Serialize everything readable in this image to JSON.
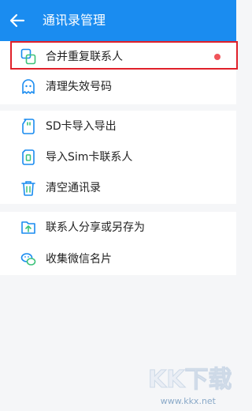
{
  "header": {
    "title": "通讯录管理",
    "back_icon": "arrow-left-icon",
    "background": "#1a8cf0"
  },
  "groups": [
    {
      "items": [
        {
          "label": "合并重复联系人",
          "icon": "merge-icon",
          "badge": true,
          "badge_color": "#f0545a"
        },
        {
          "label": "清理失效号码",
          "icon": "ghost-icon"
        }
      ]
    },
    {
      "items": [
        {
          "label": "SD卡导入导出",
          "icon": "sd-card-icon"
        },
        {
          "label": "导入Sim卡联系人",
          "icon": "sim-card-icon"
        },
        {
          "label": "清空通讯录",
          "icon": "trash-icon"
        }
      ]
    },
    {
      "items": [
        {
          "label": "联系人分享或另存为",
          "icon": "folder-upload-icon"
        },
        {
          "label": "收集微信名片",
          "icon": "wechat-icon"
        }
      ]
    }
  ],
  "accent_color": "#1a8cf0",
  "highlight_color": "#e0202a",
  "watermark": {
    "text": "www.kkx.net",
    "logo_text": "KK下载"
  }
}
